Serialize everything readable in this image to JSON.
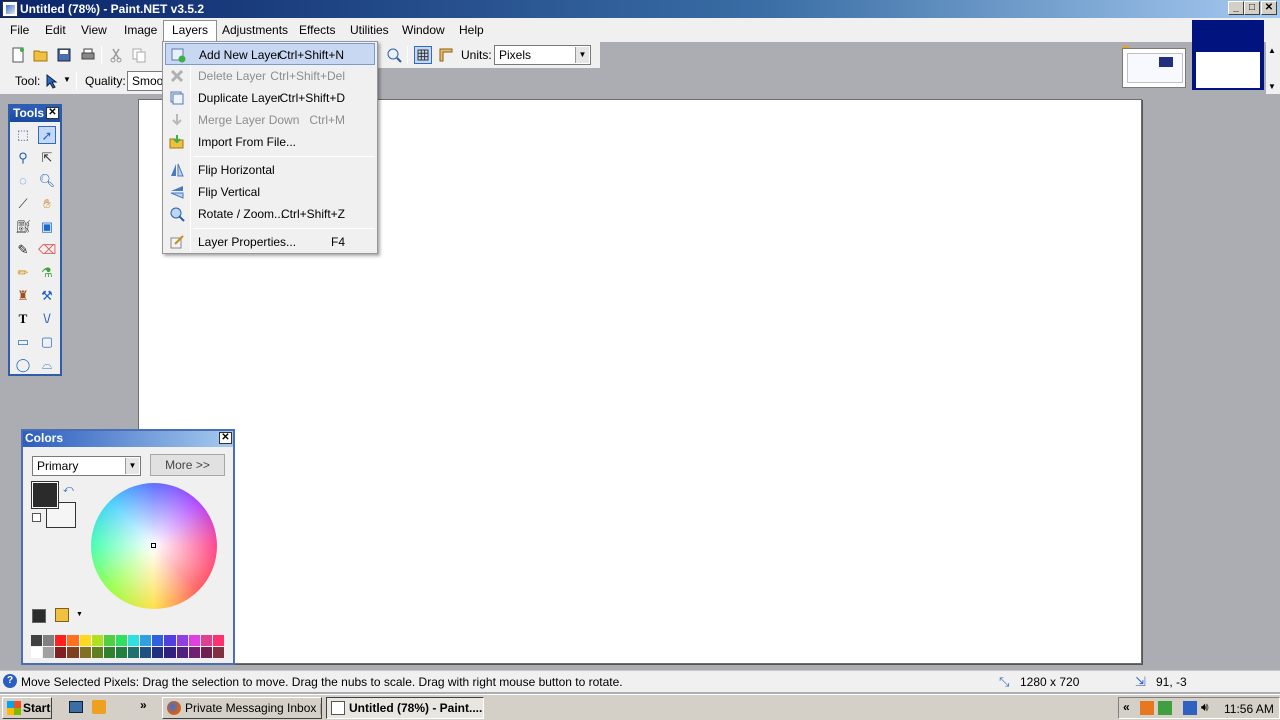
{
  "window": {
    "title": "Untitled (78%) - Paint.NET v3.5.2",
    "min": "_",
    "max": "□",
    "close": "✕"
  },
  "menubar": {
    "items": [
      "File",
      "Edit",
      "View",
      "Image",
      "Layers",
      "Adjustments",
      "Effects",
      "Utilities",
      "Window",
      "Help"
    ]
  },
  "toolbar": {
    "units_label": "Units:",
    "units_value": "Pixels",
    "tool_label": "Tool:",
    "quality_label": "Quality:",
    "quality_value": "Smoot"
  },
  "tools_window": {
    "title": "Tools",
    "close": "✕"
  },
  "colors_window": {
    "title": "Colors",
    "close": "✕",
    "mode": "Primary",
    "more_button": "More >>",
    "primary_color": "#2b2b2b",
    "secondary_color": "#f5f5f5"
  },
  "layers_menu": {
    "items": [
      {
        "label": "Add New Layer",
        "shortcut": "Ctrl+Shift+N",
        "state": "highlighted"
      },
      {
        "label": "Delete Layer",
        "shortcut": "Ctrl+Shift+Del",
        "state": "disabled"
      },
      {
        "label": "Duplicate Layer",
        "shortcut": "Ctrl+Shift+D",
        "state": "normal"
      },
      {
        "label": "Merge Layer Down",
        "shortcut": "Ctrl+M",
        "state": "disabled"
      },
      {
        "label": "Import From File...",
        "shortcut": "",
        "state": "normal"
      },
      {
        "label": "Flip Horizontal",
        "shortcut": "",
        "state": "normal"
      },
      {
        "label": "Flip Vertical",
        "shortcut": "",
        "state": "normal"
      },
      {
        "label": "Rotate / Zoom...",
        "shortcut": "Ctrl+Shift+Z",
        "state": "normal"
      },
      {
        "label": "Layer Properties...",
        "shortcut": "F4",
        "state": "normal"
      }
    ]
  },
  "statusbar": {
    "message": "Move Selected Pixels: Drag the selection to move. Drag the nubs to scale. Drag with right mouse button to rotate.",
    "image_size": "1280 x 720",
    "cursor_pos": "91, -3"
  },
  "taskbar": {
    "start": "Start",
    "tasks": [
      "Private Messaging Inbox |...",
      "Untitled (78%) - Paint...."
    ],
    "clock": "11:56 AM",
    "chevron": "»",
    "tray_chevron": "«"
  },
  "palette": [
    "#404040",
    "#808080",
    "#ff2020",
    "#ff7020",
    "#ffd820",
    "#b0e020",
    "#50d040",
    "#30e060",
    "#30e0e0",
    "#30a0e0",
    "#3060e0",
    "#5040e0",
    "#9040e0",
    "#e040e0",
    "#e04090",
    "#ff3070",
    "#ffffff",
    "#a0a0a0",
    "#802020",
    "#804020",
    "#807020",
    "#608020",
    "#308030",
    "#208040",
    "#207070",
    "#205080",
    "#203080",
    "#302080",
    "#502080",
    "#702070",
    "#702050",
    "#803040"
  ]
}
